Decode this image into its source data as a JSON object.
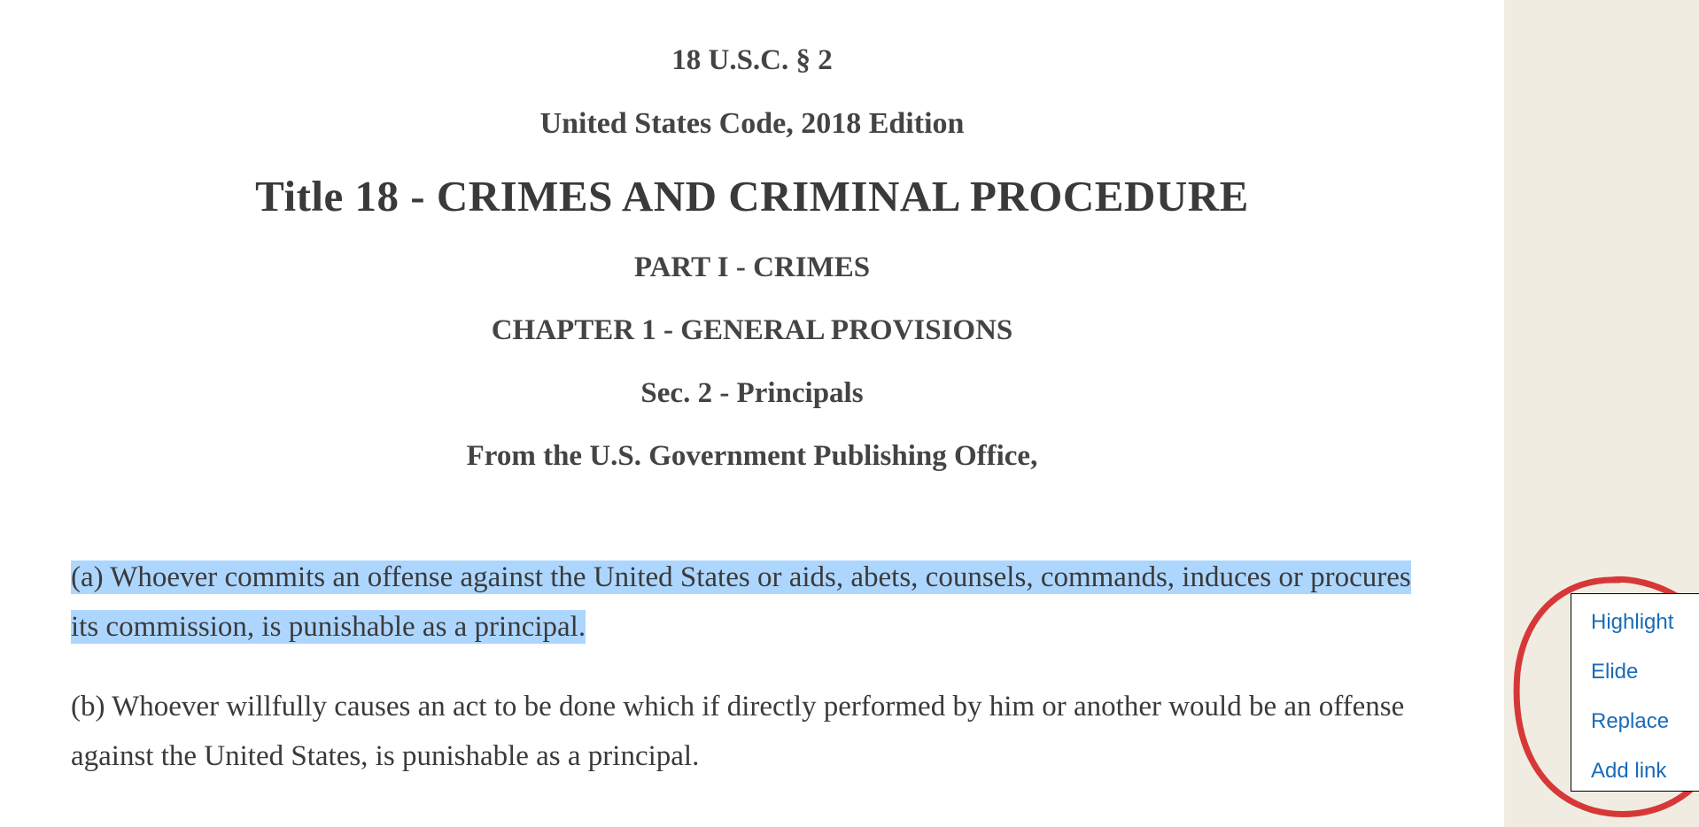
{
  "document": {
    "citation": "18 U.S.C. § 2",
    "edition": "United States Code, 2018 Edition",
    "title": "Title 18 - CRIMES AND CRIMINAL PROCEDURE",
    "part": "PART I - CRIMES",
    "chapter": "CHAPTER 1 - GENERAL PROVISIONS",
    "section": "Sec. 2 - Principals",
    "source": "From the U.S. Government Publishing Office,",
    "paragraph_a": "(a) Whoever commits an offense against the United States or aids, abets, counsels, commands, induces or procures its commission, is punishable as a principal.",
    "paragraph_b": "(b) Whoever willfully causes an act to be done which if directly performed by him or another would be an offense against the United States, is punishable as a principal."
  },
  "contextMenu": {
    "items": [
      "Highlight",
      "Elide",
      "Replace",
      "Add link"
    ]
  }
}
